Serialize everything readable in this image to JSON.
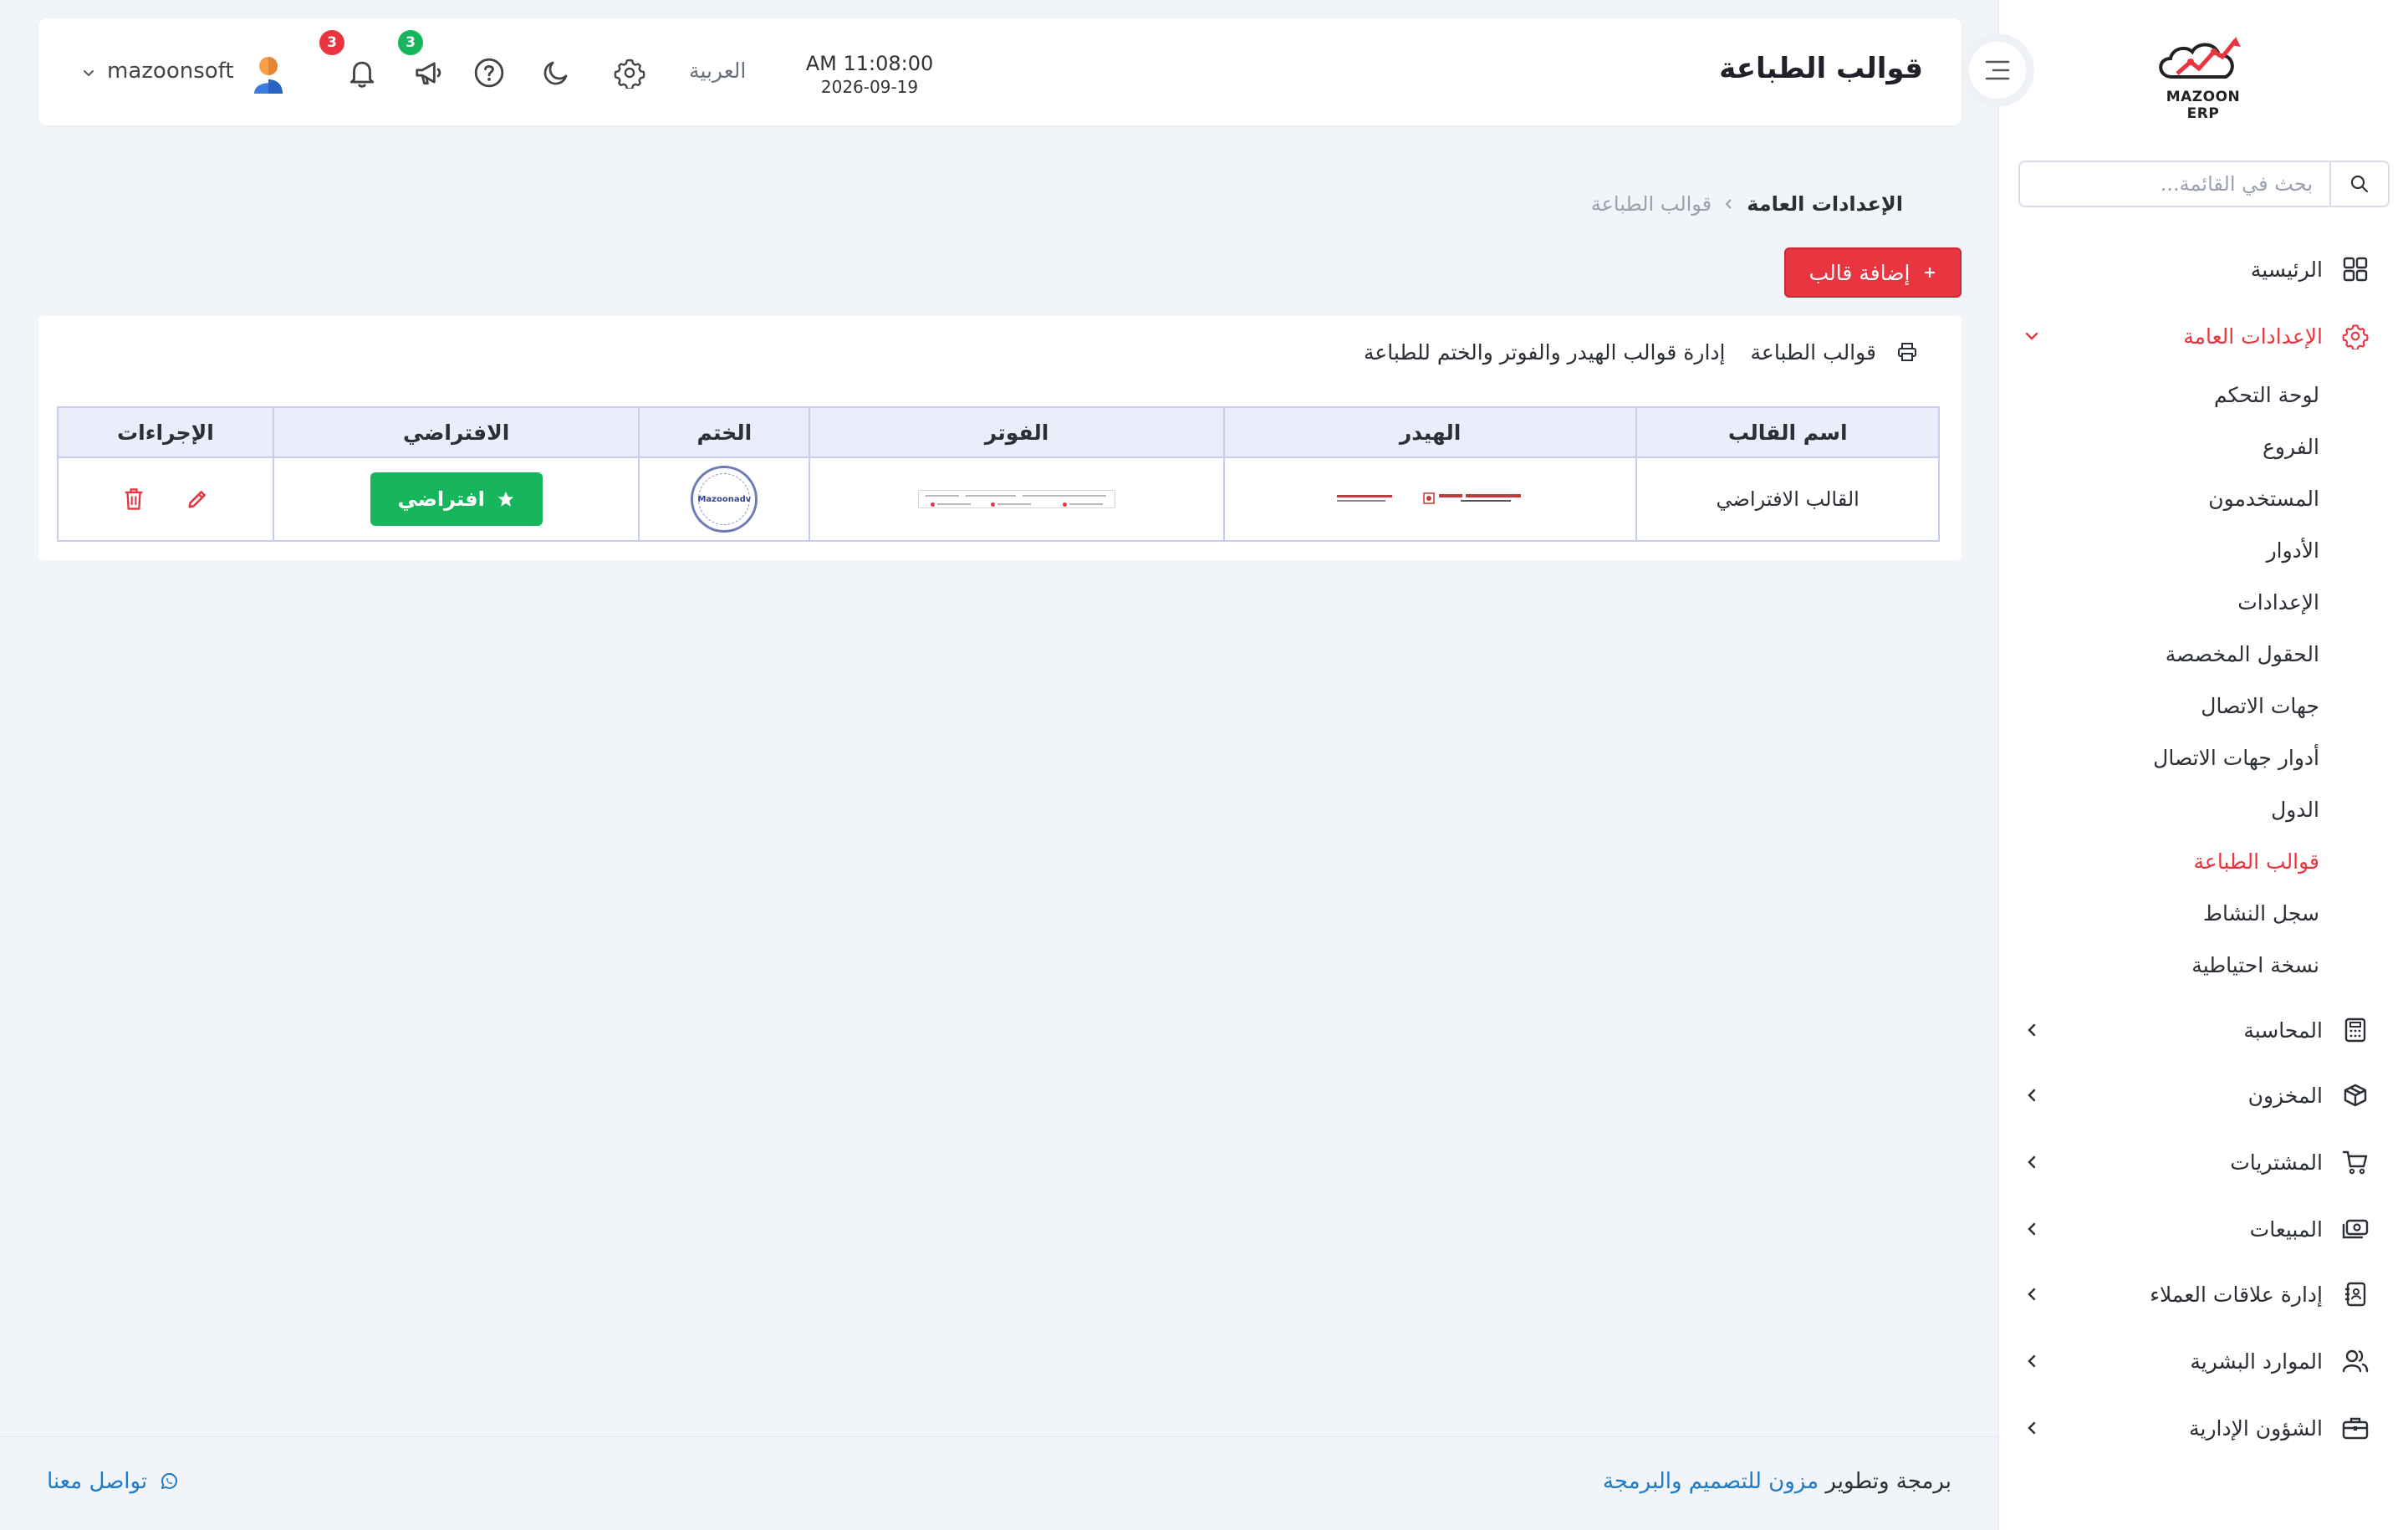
{
  "sidebar": {
    "logo_text": "MAZOON ERP",
    "logo_arabic": "مزون",
    "search_placeholder": "بحث في القائمة...",
    "items": [
      {
        "label": "الرئيسية",
        "icon": "grid-icon"
      },
      {
        "label": "الإعدادات العامة",
        "icon": "gear-icon",
        "active": true
      },
      {
        "label": "المحاسبة",
        "icon": "calculator-icon"
      },
      {
        "label": "المخزون",
        "icon": "box-icon"
      },
      {
        "label": "المشتريات",
        "icon": "cart-icon"
      },
      {
        "label": "المبيعات",
        "icon": "cash-icon"
      },
      {
        "label": "إدارة علاقات العملاء",
        "icon": "contacts-book-icon"
      },
      {
        "label": "الموارد البشرية",
        "icon": "users-icon"
      },
      {
        "label": "الشؤون الإدارية",
        "icon": "briefcase-icon"
      }
    ],
    "sub_items": [
      "لوحة التحكم",
      "الفروع",
      "المستخدمون",
      "الأدوار",
      "الإعدادات",
      "الحقول المخصصة",
      "جهات الاتصال",
      "أدوار جهات الاتصال",
      "الدول",
      "قوالب الطباعة",
      "سجل النشاط",
      "نسخة احتياطية"
    ],
    "active_sub": "قوالب الطباعة"
  },
  "header": {
    "title": "قوالب الطباعة",
    "time": "AM 11:08:00",
    "date": "2026-09-19",
    "language": "العربية",
    "announcements_count": "3",
    "notifications_count": "3",
    "username": "mazoonsoft"
  },
  "breadcrumb": {
    "parent": "الإعدادات العامة",
    "current": "قوالب الطباعة"
  },
  "add_button_label": "إضافة قالب",
  "card": {
    "title": "قوالب الطباعة",
    "subtitle": "إدارة قوالب الهيدر والفوتر والختم للطباعة"
  },
  "table": {
    "columns": [
      "اسم القالب",
      "الهيدر",
      "الفوتر",
      "الختم",
      "الافتراضي",
      "الإجراءات"
    ],
    "rows": [
      {
        "name": "القالب الافتراضي",
        "stamp_text": "Mazoonadv",
        "default_label": "افتراضي"
      }
    ]
  },
  "footer": {
    "credit_prefix": "برمجة وتطوير",
    "credit_link": "مزون للتصميم والبرمجة",
    "contact": "تواصل معنا"
  },
  "colors": {
    "accent": "#e8353f",
    "success": "#17b65c",
    "link": "#1f7ac7",
    "table_header": "#ebedfb"
  }
}
